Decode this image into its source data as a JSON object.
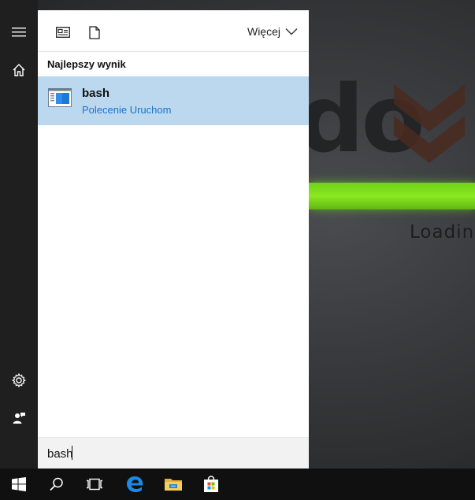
{
  "desktop": {
    "background_brand_text": "do",
    "loading_text": "Loadin",
    "accent_green": "#7ed321"
  },
  "start_rail": {
    "items": [
      {
        "name": "hamburger-menu",
        "icon": "hamburger-icon"
      },
      {
        "name": "home",
        "icon": "home-icon"
      },
      {
        "name": "settings",
        "icon": "gear-icon"
      },
      {
        "name": "feedback",
        "icon": "feedback-person-icon"
      }
    ]
  },
  "toolbar": {
    "filter_icons": [
      "apps-filter-icon",
      "documents-filter-icon"
    ],
    "more_label": "Więcej"
  },
  "results": {
    "heading": "Najlepszy wynik",
    "best_match": {
      "title": "bash",
      "subtitle": "Polecenie Uruchom",
      "icon": "app-window-icon",
      "highlight_color": "#bcd8ee",
      "subtitle_color": "#1a73c9"
    }
  },
  "search": {
    "value": "bash"
  },
  "taskbar": {
    "items": [
      {
        "name": "start",
        "icon": "windows-logo-icon"
      },
      {
        "name": "search",
        "icon": "search-icon"
      },
      {
        "name": "task-view",
        "icon": "task-view-icon"
      },
      {
        "name": "edge",
        "icon": "edge-browser-icon"
      },
      {
        "name": "file-explorer",
        "icon": "folder-icon"
      },
      {
        "name": "store",
        "icon": "store-bag-icon"
      }
    ]
  }
}
